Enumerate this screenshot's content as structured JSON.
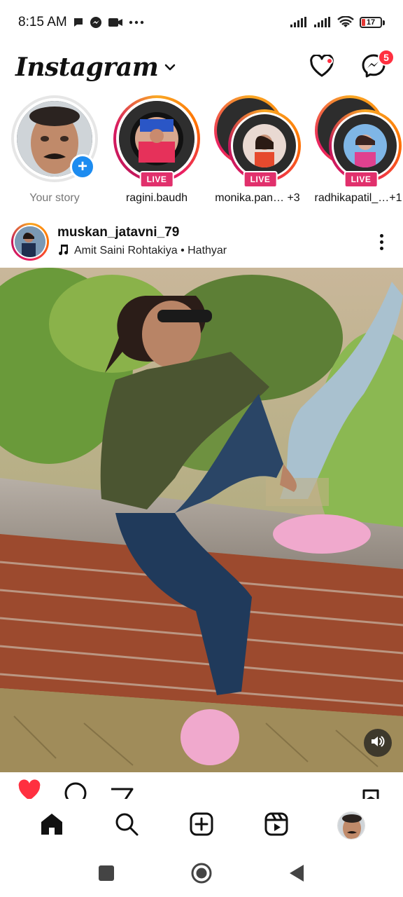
{
  "status_bar": {
    "time": "8:15 AM",
    "left_icons": [
      "chat-bubble-icon",
      "messenger-icon",
      "video-camera-icon",
      "more-dots-icon"
    ],
    "right_icons": [
      "signal-icon",
      "signal-icon",
      "wifi-icon"
    ],
    "battery_level": "17",
    "battery_color": "#e53935"
  },
  "header": {
    "logo": "Instagram",
    "notifications_dot_color": "#ff3040",
    "messages_badge": "5"
  },
  "stories": [
    {
      "name": "Your story",
      "type": "own"
    },
    {
      "name": "ragini.baudh",
      "badge": "LIVE",
      "type": "live"
    },
    {
      "name": "monika.pan… +3",
      "badge": "LIVE",
      "type": "live-group"
    },
    {
      "name": "radhikapatil_…+1",
      "badge": "LIVE",
      "type": "live-group"
    }
  ],
  "post": {
    "username": "muskan_jatavni_79",
    "audio": "Amit Saini Rohtakiya • Hathyar"
  },
  "bottom_nav": [
    "home-icon",
    "search-icon",
    "create-icon",
    "reels-icon",
    "profile-avatar"
  ],
  "system_nav": [
    "recents-icon",
    "home-circle-icon",
    "back-icon"
  ],
  "colors": {
    "accent_live": "#e1306c",
    "add_story_blue": "#1d8cf0",
    "like_red": "#ff3040"
  }
}
